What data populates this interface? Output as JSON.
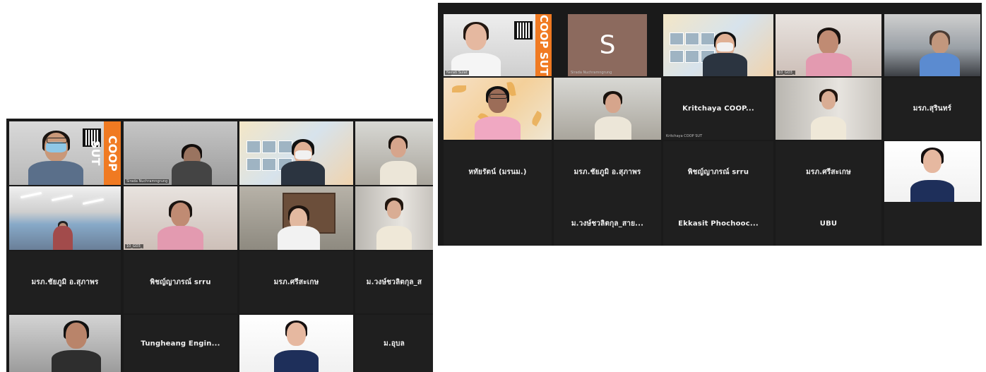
{
  "left_panel": {
    "tiles": [
      {
        "id": "l-r1c1",
        "kind": "video",
        "name": "",
        "badge": "COOP SUT",
        "scene": "person-mask"
      },
      {
        "id": "l-r1c2",
        "kind": "video",
        "name": "Sirada Nuchramngrung",
        "scene": "person-dim"
      },
      {
        "id": "l-r1c3",
        "kind": "video",
        "name": "",
        "scene": "poster-person"
      },
      {
        "id": "l-r1c4",
        "kind": "video",
        "name": "",
        "scene": "person-woman"
      },
      {
        "id": "l-r2c1",
        "kind": "video",
        "name": "",
        "scene": "office"
      },
      {
        "id": "l-r2c2",
        "kind": "video",
        "name": "10_GO3_",
        "scene": "person-woman2"
      },
      {
        "id": "l-r2c3",
        "kind": "video",
        "name": "",
        "scene": "person-woman3"
      },
      {
        "id": "l-r2c4",
        "kind": "video",
        "name": "",
        "scene": "person-woman4"
      },
      {
        "id": "l-r3c1",
        "kind": "name",
        "label": "มรภ.ชัยภูมิ อ.สุภาพร",
        "name": ""
      },
      {
        "id": "l-r3c2",
        "kind": "name",
        "label": "พิชญ์ญาภรณ์ srru",
        "name": ""
      },
      {
        "id": "l-r3c3",
        "kind": "name",
        "label": "มรภ.ศรีสะเกษ",
        "name": ""
      },
      {
        "id": "l-r3c4",
        "kind": "name",
        "label": "ม.วงษ์ชวลิตกุล_ส",
        "name": ""
      },
      {
        "id": "l-r4c1",
        "kind": "video",
        "name": "",
        "scene": "person-man"
      },
      {
        "id": "l-r4c2",
        "kind": "name",
        "label": "Tungheang  Engin...",
        "name": ""
      },
      {
        "id": "l-r4c3",
        "kind": "video",
        "name": "",
        "scene": "person-woman-suit"
      },
      {
        "id": "l-r4c4",
        "kind": "name",
        "label": "ม.อุบล",
        "name": ""
      }
    ]
  },
  "right_panel": {
    "tiles": [
      {
        "id": "r-r1c1",
        "kind": "video",
        "name": "Nerati Sulat",
        "badge": "COOP SUT",
        "scene": "woman-poster"
      },
      {
        "id": "r-r1c2",
        "kind": "avatar",
        "letter": "S",
        "name": "Sirada Nuchramngrung"
      },
      {
        "id": "r-r1c3",
        "kind": "video",
        "name": "",
        "scene": "poster-person"
      },
      {
        "id": "r-r1c4",
        "kind": "video",
        "name": "10_GO3_",
        "scene": "person-woman2"
      },
      {
        "id": "r-r1c5",
        "kind": "video",
        "name": "",
        "scene": "car-man"
      },
      {
        "id": "r-r2c1",
        "kind": "video",
        "name": "",
        "scene": "woman-floral"
      },
      {
        "id": "r-r2c2",
        "kind": "video",
        "name": "",
        "scene": "person-woman"
      },
      {
        "id": "r-r2c3",
        "kind": "name",
        "label": "Kritchaya  COOP...",
        "name": "Kritchaya COOP SUT"
      },
      {
        "id": "r-r2c4",
        "kind": "video",
        "name": "",
        "scene": "person-woman4"
      },
      {
        "id": "r-r2c5",
        "kind": "name",
        "label": "มรภ.สุรินทร์",
        "name": ""
      },
      {
        "id": "r-r3c1",
        "kind": "name",
        "label": "หทัยรัตน์ (มรนม.)",
        "name": ""
      },
      {
        "id": "r-r3c2",
        "kind": "name",
        "label": "มรภ.ชัยภูมิ อ.สุภาพร",
        "name": ""
      },
      {
        "id": "r-r3c3",
        "kind": "name",
        "label": "พิชญ์ญาภรณ์ srru",
        "name": ""
      },
      {
        "id": "r-r3c4",
        "kind": "name",
        "label": "มรภ.ศรีสะเกษ",
        "name": ""
      },
      {
        "id": "r-r3c5",
        "kind": "video",
        "name": "",
        "scene": "person-woman-suit"
      },
      {
        "id": "r-r4c1",
        "kind": "empty",
        "name": ""
      },
      {
        "id": "r-r4c2",
        "kind": "name",
        "label": "ม.วงษ์ชวลิตกุล_สาย...",
        "name": ""
      },
      {
        "id": "r-r4c3",
        "kind": "name",
        "label": "Ekkasit  Phochooc...",
        "name": ""
      },
      {
        "id": "r-r4c4",
        "kind": "name",
        "label": "UBU",
        "name": ""
      },
      {
        "id": "r-r4c5",
        "kind": "empty",
        "name": ""
      }
    ]
  }
}
